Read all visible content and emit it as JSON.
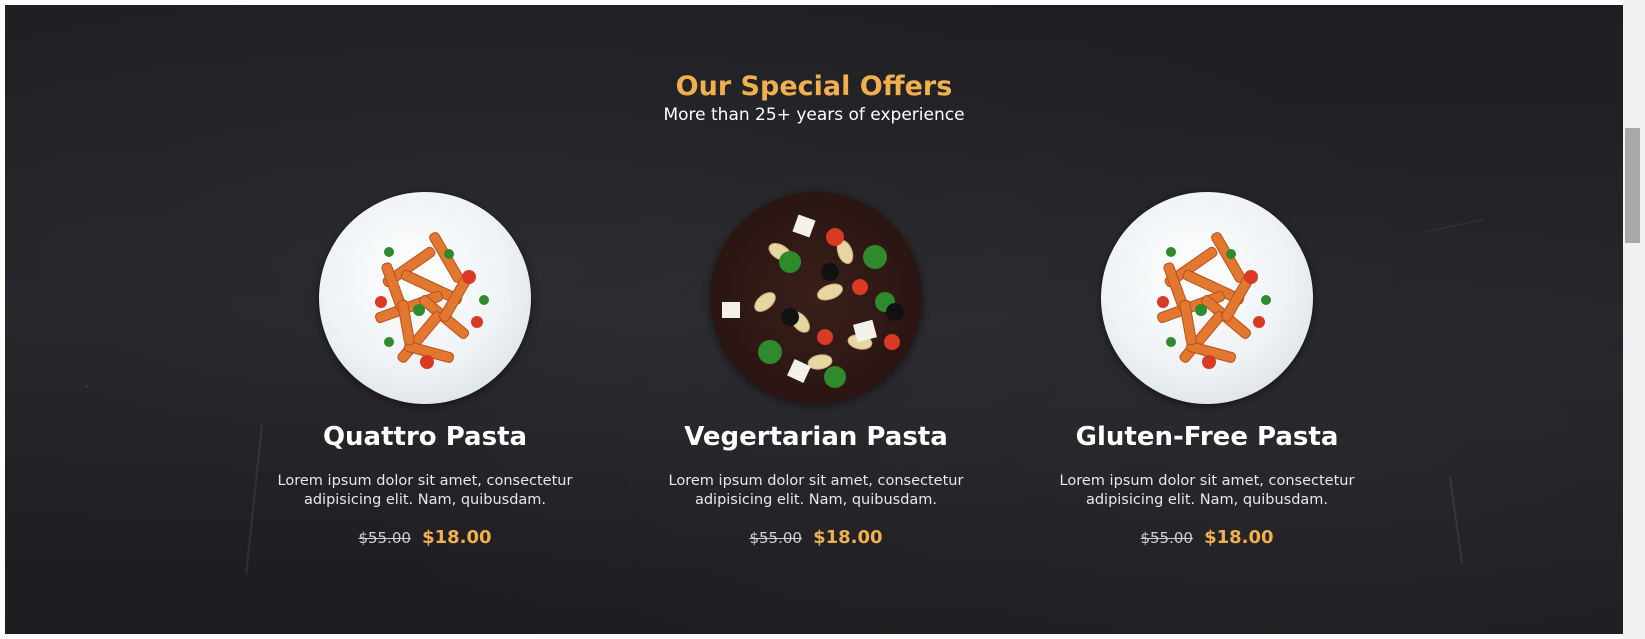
{
  "section": {
    "title": "Our Special Offers",
    "subtitle": "More than 25+ years of experience"
  },
  "offers": [
    {
      "name": "Quattro Pasta",
      "description": "Lorem ipsum dolor sit amet, consectetur adipisicing elit. Nam, quibusdam.",
      "old_price": "$55.00",
      "price": "$18.00",
      "image": "penne-plate-image"
    },
    {
      "name": "Vegertarian Pasta",
      "description": "Lorem ipsum dolor sit amet, consectetur adipisicing elit. Nam, quibusdam.",
      "old_price": "$55.00",
      "price": "$18.00",
      "image": "fusilli-salad-bowl-image"
    },
    {
      "name": "Gluten-Free Pasta",
      "description": "Lorem ipsum dolor sit amet, consectetur adipisicing elit. Nam, quibusdam.",
      "old_price": "$55.00",
      "price": "$18.00",
      "image": "penne-plate-image"
    }
  ],
  "colors": {
    "accent": "#efb04d",
    "background": "#222226",
    "text": "#ffffff"
  }
}
